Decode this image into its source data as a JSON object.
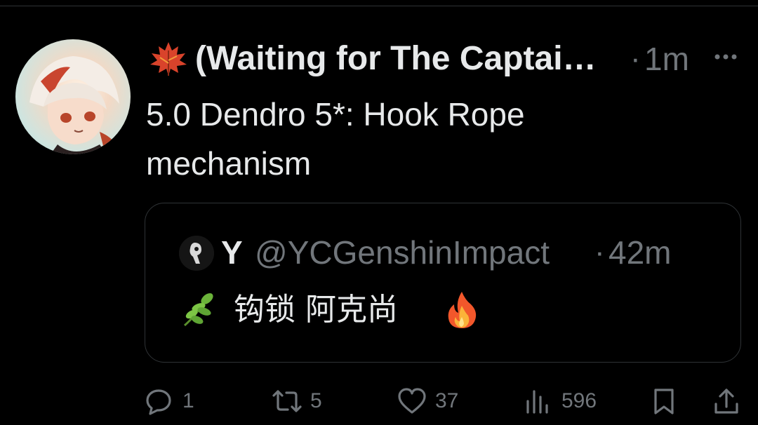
{
  "tweet": {
    "author_name": "(Waiting for The Captai…",
    "time_ago": "1m",
    "separator": "·",
    "text_line1": "5.0 Dendro 5*: Hook Rope",
    "text_line2": "mechanism"
  },
  "quoted": {
    "name": "Y",
    "handle": "@YCGenshinImpact",
    "separator": "·",
    "time_ago": "42m",
    "text": "钩锁 阿克尚"
  },
  "actions": {
    "reply_count": "1",
    "repost_count": "5",
    "like_count": "37",
    "views_count": "596"
  },
  "icons": {
    "name_prefix": "maple-leaf-icon",
    "quote_prefix": "herb-icon",
    "quote_suffix": "fire-icon",
    "reply": "reply-icon",
    "repost": "repost-icon",
    "like": "heart-icon",
    "views": "views-icon",
    "bookmark": "bookmark-icon",
    "share": "share-icon",
    "more": "more-icon"
  },
  "colors": {
    "background": "#000000",
    "text": "#e7e9ea",
    "secondary": "#71767b",
    "border": "#2f3336"
  }
}
